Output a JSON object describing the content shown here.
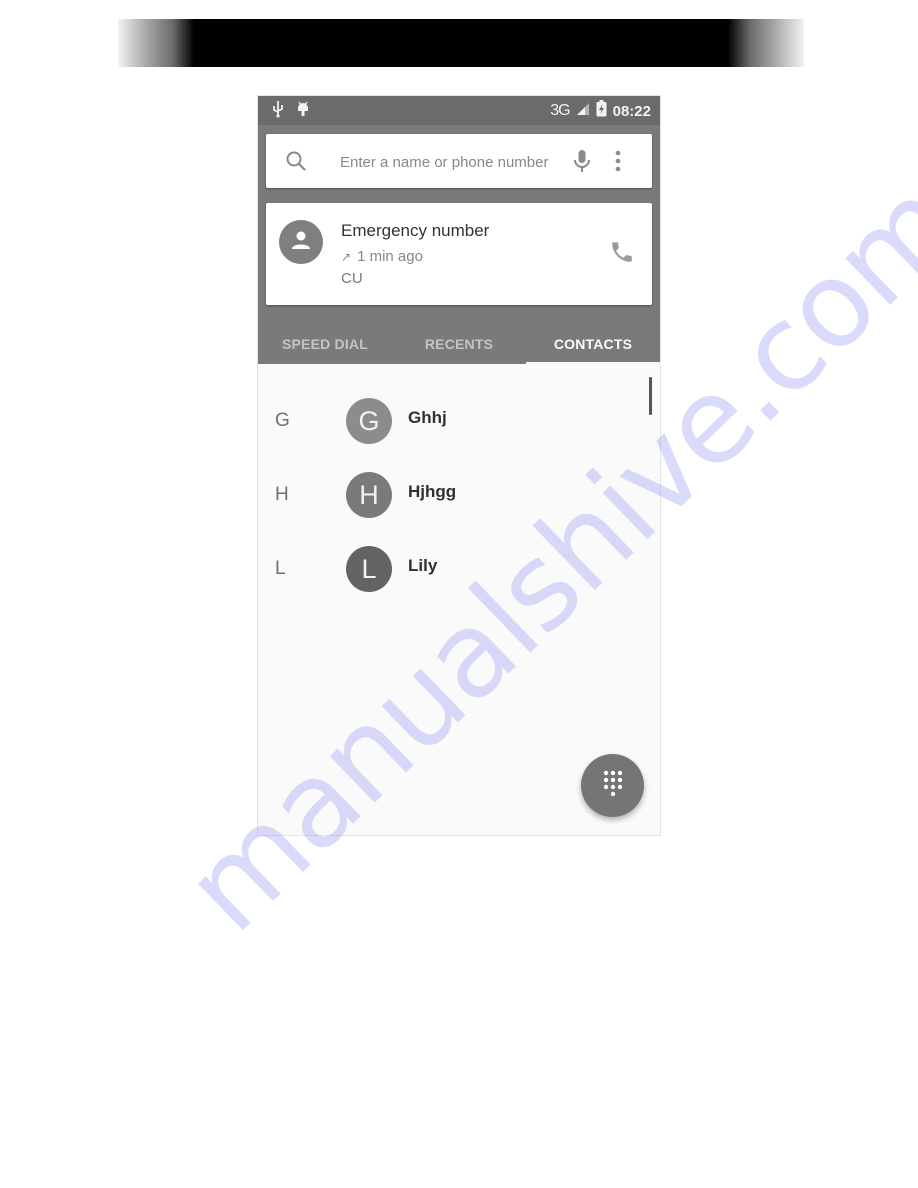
{
  "status_bar": {
    "left_icons": [
      "usb-icon",
      "android-debug-icon"
    ],
    "network": "3G",
    "time": "08:22"
  },
  "search": {
    "placeholder": "Enter a name or phone number",
    "value": ""
  },
  "recent_call": {
    "name": "Emergency number",
    "direction_glyph": "↗",
    "time_ago": "1 min ago",
    "label": "CU"
  },
  "tabs": [
    {
      "label": "SPEED DIAL",
      "active": false
    },
    {
      "label": "RECENTS",
      "active": false
    },
    {
      "label": "CONTACTS",
      "active": true
    }
  ],
  "contacts": [
    {
      "section": "G",
      "initial": "G",
      "name": "Ghhj",
      "color": "#8c8c8c"
    },
    {
      "section": "H",
      "initial": "H",
      "name": "Hjhgg",
      "color": "#7a7a7a"
    },
    {
      "section": "L",
      "initial": "L",
      "name": "Lily",
      "color": "#636363"
    }
  ],
  "colors": {
    "app_bar": "#7a7a7a",
    "status_bar": "#6b6b6b",
    "fab": "#757575",
    "watermark": "#a0a0f0"
  },
  "watermark": "manualshive.com"
}
